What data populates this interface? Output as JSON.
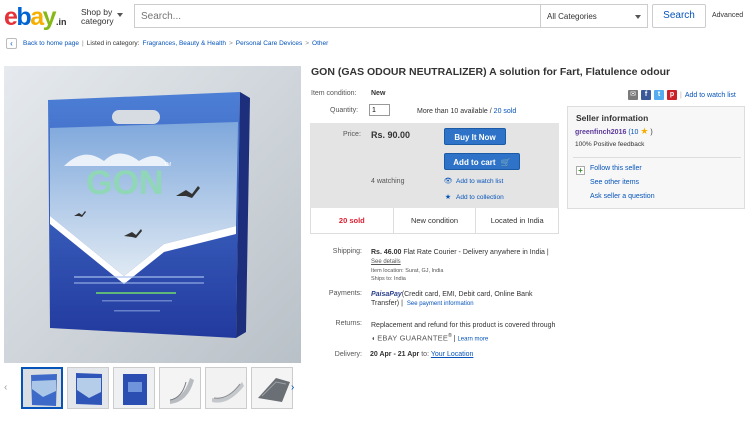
{
  "header": {
    "logo_tld": ".in",
    "shop_by_line1": "Shop by",
    "shop_by_line2": "category",
    "search_placeholder": "Search...",
    "category_select": "All Categories",
    "search_button": "Search",
    "advanced": "Advanced"
  },
  "breadcrumb": {
    "back": "Back to home page",
    "listed_in": "Listed in category:",
    "items": [
      "Fragrances, Beauty & Health",
      "Personal Care Devices",
      "Other"
    ]
  },
  "product": {
    "title": "GON (GAS ODOUR NEUTRALIZER) A solution for Fart, Flatulence odour",
    "condition_label": "Item condition:",
    "condition": "New",
    "quantity_label": "Quantity:",
    "quantity": "1",
    "available": "More than 10 available /",
    "sold_link": "20 sold",
    "price_label": "Price:",
    "price": "Rs. 90.00",
    "buy_now": "Buy It Now",
    "add_to_cart": "Add to cart",
    "watching": "4 watching",
    "add_watch": "Add to watch list",
    "add_collection": "Add to collection",
    "stats": [
      "20 sold",
      "New condition",
      "Located in India"
    ]
  },
  "shipping": {
    "label": "Shipping:",
    "cost": "Rs. 46.00",
    "service": "Flat Rate Courier - Delivery anywhere in India |",
    "see_details": "See details",
    "location": "Item location: Surat, GJ, India",
    "ships_to": "Ships to: India"
  },
  "payments": {
    "label": "Payments:",
    "brand": "PaisaPay",
    "text": "(Credit card, EMI, Debit card, Online Bank Transfer) |",
    "link": "See payment information"
  },
  "returns": {
    "label": "Returns:",
    "text": "Replacement and refund for this product is covered through",
    "guarantee": "EBAY GUARANTEE",
    "learn": "Learn more"
  },
  "delivery": {
    "label": "Delivery:",
    "dates": "20 Apr - 21 Apr",
    "to": "to:",
    "location": "Your Location"
  },
  "right": {
    "watch_list": "Add to watch list",
    "seller_title": "Seller information",
    "seller_name": "greenfinch2016",
    "seller_score": "(10",
    "seller_score_end": ")",
    "feedback": "100% Positive feedback",
    "follow": "Follow this seller",
    "other_items": "See other items",
    "ask": "Ask seller a question"
  },
  "image": {
    "brand_text": "GON",
    "tm": "TM"
  },
  "colors": {
    "accent_blue": "#2e73c7",
    "sold_red": "#dd1e31",
    "link": "#0654ba"
  }
}
